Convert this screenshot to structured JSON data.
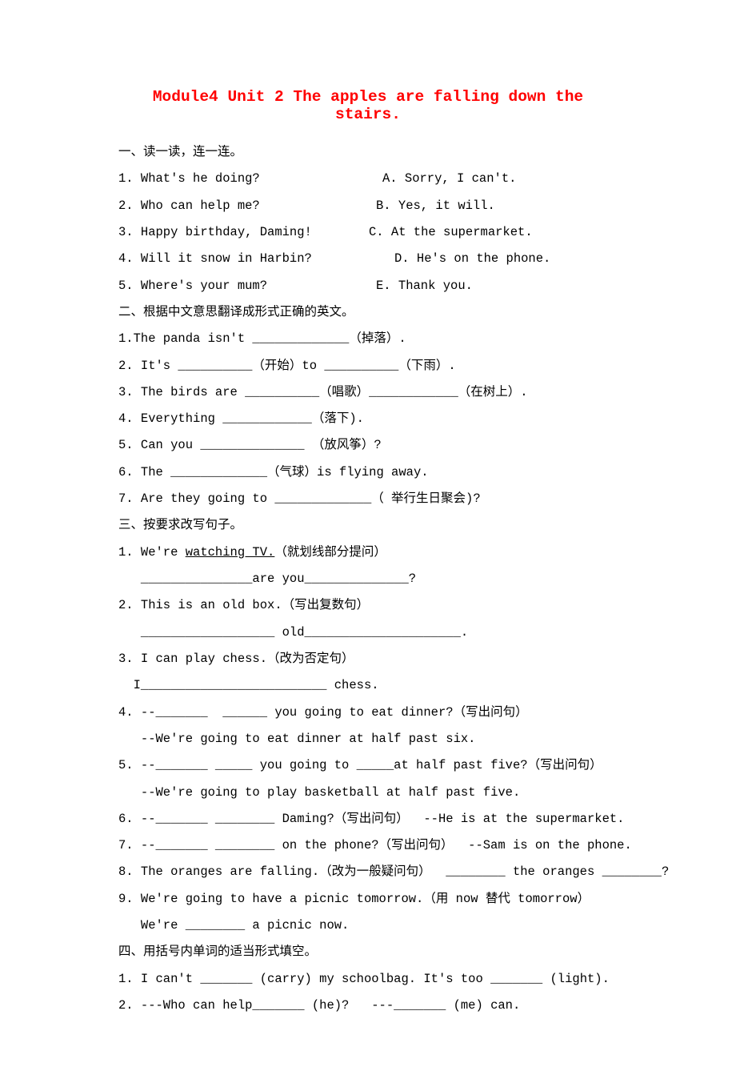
{
  "title": "Module4 Unit 2 The apples are falling down the stairs.",
  "section1_header": "一、读一读，连一连。",
  "s1": {
    "q1": "1. What's he doing?",
    "a1": "A. Sorry, I can't.",
    "q2": "2. Who can help me?",
    "a2": "B. Yes, it will.",
    "q3": "3. Happy birthday, Daming!",
    "a3": "C. At the supermarket.",
    "q4": "4. Will it snow in Harbin?",
    "a4": "D. He's on the phone.",
    "q5": "5. Where's your mum?",
    "a5": "E. Thank you."
  },
  "section2_header": "二、根据中文意思翻译成形式正确的英文。",
  "s2": {
    "l1a": "1.The panda isn't _____________（掉落）.",
    "l2": "2. It's __________（开始）to __________（下雨）.",
    "l3": "3. The birds are __________（唱歌）____________（在树上）.",
    "l4": "4. Everything ____________（落下).",
    "l5": "5. Can you ______________ （放风筝）?",
    "l6": "6. The _____________（气球）is flying away.",
    "l7": "7. Are they going to _____________（ 举行生日聚会)?"
  },
  "section3_header": "三、按要求改写句子。",
  "s3": {
    "l1a": "1. We're ",
    "l1u": "watching TV.",
    "l1b": "（就划线部分提问）",
    "l1c": "   _______________are you______________?",
    "l2a": "2. This is an old box.（写出复数句）",
    "l2b": "   __________________ old_____________________.",
    "l3a": "3. I can play chess.（改为否定句）",
    "l3b": "  I_________________________ chess.",
    "l4a": "4. --_______  ______ you going to eat dinner?（写出问句）",
    "l4b": "   --We're going to eat dinner at half past six.",
    "l5a": "5. --_______ _____ you going to _____at half past five?（写出问句）",
    "l5b": "   --We're going to play basketball at half past five.",
    "l6": "6. --_______ ________ Daming?（写出问句）  --He is at the supermarket.",
    "l7": "7. --_______ ________ on the phone?（写出问句）  --Sam is on the phone.",
    "l8": "8. The oranges are falling.（改为一般疑问句）  ________ the oranges ________?",
    "l9a": "9. We're going to have a picnic tomorrow.（用 now 替代 tomorrow）",
    "l9b": "   We're ________ a picnic now."
  },
  "section4_header": "四、用括号内单词的适当形式填空。",
  "s4": {
    "l1": "1. I can't _______ (carry) my schoolbag. It's too _______ (light).",
    "l2": "2. ---Who can help_______ (he)?   ---_______ (me) can."
  }
}
